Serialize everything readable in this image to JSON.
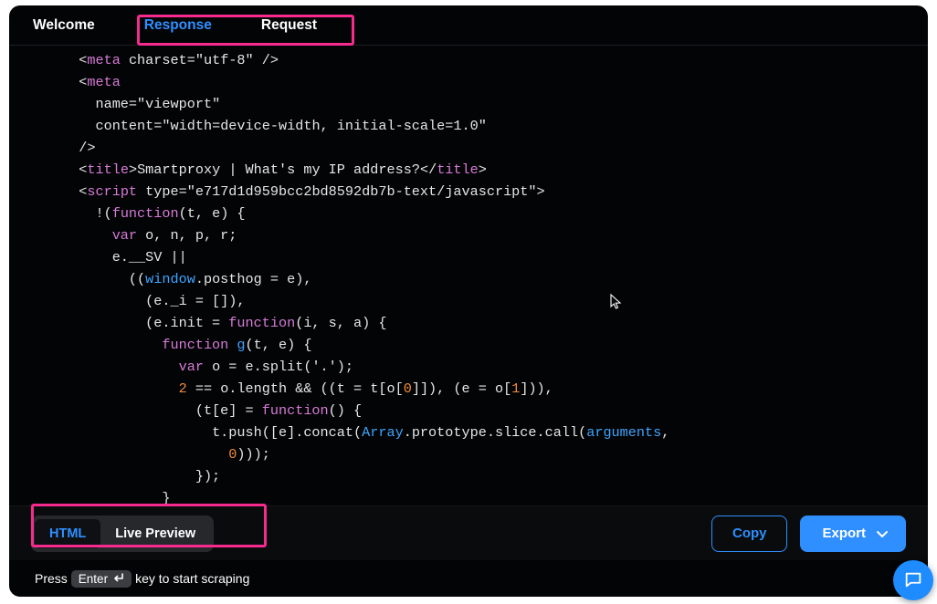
{
  "tabs": {
    "welcome": "Welcome",
    "response": "Response",
    "request": "Request"
  },
  "code": {
    "lines": [
      {
        "indent": 1,
        "segs": [
          [
            "punct",
            "<"
          ],
          [
            "tag",
            "meta"
          ],
          [
            "plain",
            " charset="
          ],
          [
            "str",
            "\"utf-8\""
          ],
          [
            "plain",
            " />"
          ]
        ]
      },
      {
        "indent": 1,
        "segs": [
          [
            "punct",
            "<"
          ],
          [
            "tag",
            "meta"
          ]
        ]
      },
      {
        "indent": 2,
        "segs": [
          [
            "plain",
            "name="
          ],
          [
            "str",
            "\"viewport\""
          ]
        ]
      },
      {
        "indent": 2,
        "segs": [
          [
            "plain",
            "content="
          ],
          [
            "str",
            "\"width=device-width, initial-scale=1.0\""
          ]
        ]
      },
      {
        "indent": 1,
        "segs": [
          [
            "plain",
            "/>"
          ]
        ]
      },
      {
        "indent": 1,
        "segs": [
          [
            "punct",
            "<"
          ],
          [
            "tag",
            "title"
          ],
          [
            "punct",
            ">"
          ],
          [
            "plain",
            "Smartproxy | What's my IP address?"
          ],
          [
            "punct",
            "</"
          ],
          [
            "tag",
            "title"
          ],
          [
            "punct",
            ">"
          ]
        ]
      },
      {
        "indent": 1,
        "segs": [
          [
            "punct",
            "<"
          ],
          [
            "tag",
            "script"
          ],
          [
            "plain",
            " type="
          ],
          [
            "str",
            "\"e717d1d959bcc2bd8592db7b-text/javascript\""
          ],
          [
            "punct",
            ">"
          ]
        ]
      },
      {
        "indent": 2,
        "segs": [
          [
            "plain",
            "!("
          ],
          [
            "kw",
            "function"
          ],
          [
            "plain",
            "(t, e) {"
          ]
        ]
      },
      {
        "indent": 3,
        "segs": [
          [
            "kw",
            "var"
          ],
          [
            "plain",
            " o, n, p, r;"
          ]
        ]
      },
      {
        "indent": 3,
        "segs": [
          [
            "plain",
            "e.__SV ||"
          ]
        ]
      },
      {
        "indent": 4,
        "segs": [
          [
            "plain",
            "(("
          ],
          [
            "ident",
            "window"
          ],
          [
            "plain",
            ".posthog = e),"
          ]
        ]
      },
      {
        "indent": 5,
        "segs": [
          [
            "plain",
            "(e._i = []),"
          ]
        ]
      },
      {
        "indent": 5,
        "segs": [
          [
            "plain",
            "(e.init = "
          ],
          [
            "kw",
            "function"
          ],
          [
            "plain",
            "(i, s, a) {"
          ]
        ]
      },
      {
        "indent": 6,
        "segs": [
          [
            "kw",
            "function"
          ],
          [
            "plain",
            " "
          ],
          [
            "fn",
            "g"
          ],
          [
            "plain",
            "(t, e) {"
          ]
        ]
      },
      {
        "indent": 7,
        "segs": [
          [
            "kw",
            "var"
          ],
          [
            "plain",
            " o = e.split("
          ],
          [
            "str",
            "'.'"
          ],
          [
            "plain",
            ");"
          ]
        ]
      },
      {
        "indent": 7,
        "segs": [
          [
            "num",
            "2"
          ],
          [
            "plain",
            " == o.length && ((t = t[o["
          ],
          [
            "num",
            "0"
          ],
          [
            "plain",
            "]]), (e = o["
          ],
          [
            "num",
            "1"
          ],
          [
            "plain",
            "])),"
          ]
        ]
      },
      {
        "indent": 8,
        "segs": [
          [
            "plain",
            "(t[e] = "
          ],
          [
            "kw",
            "function"
          ],
          [
            "plain",
            "() {"
          ]
        ]
      },
      {
        "indent": 9,
        "segs": [
          [
            "plain",
            "t.push([e].concat("
          ],
          [
            "ident",
            "Array"
          ],
          [
            "plain",
            ".prototype.slice.call("
          ],
          [
            "ident",
            "arguments"
          ],
          [
            "plain",
            ","
          ]
        ]
      },
      {
        "indent": 10,
        "segs": [
          [
            "num",
            "0"
          ],
          [
            "plain",
            ")));"
          ]
        ]
      },
      {
        "indent": 8,
        "segs": [
          [
            "plain",
            "});"
          ]
        ]
      },
      {
        "indent": 6,
        "segs": [
          [
            "plain",
            "}"
          ]
        ]
      }
    ]
  },
  "footer": {
    "html": "HTML",
    "live": "Live Preview",
    "copy": "Copy",
    "export": "Export"
  },
  "hint": {
    "press": "Press",
    "key": "Enter",
    "rest": "key to start scraping"
  }
}
